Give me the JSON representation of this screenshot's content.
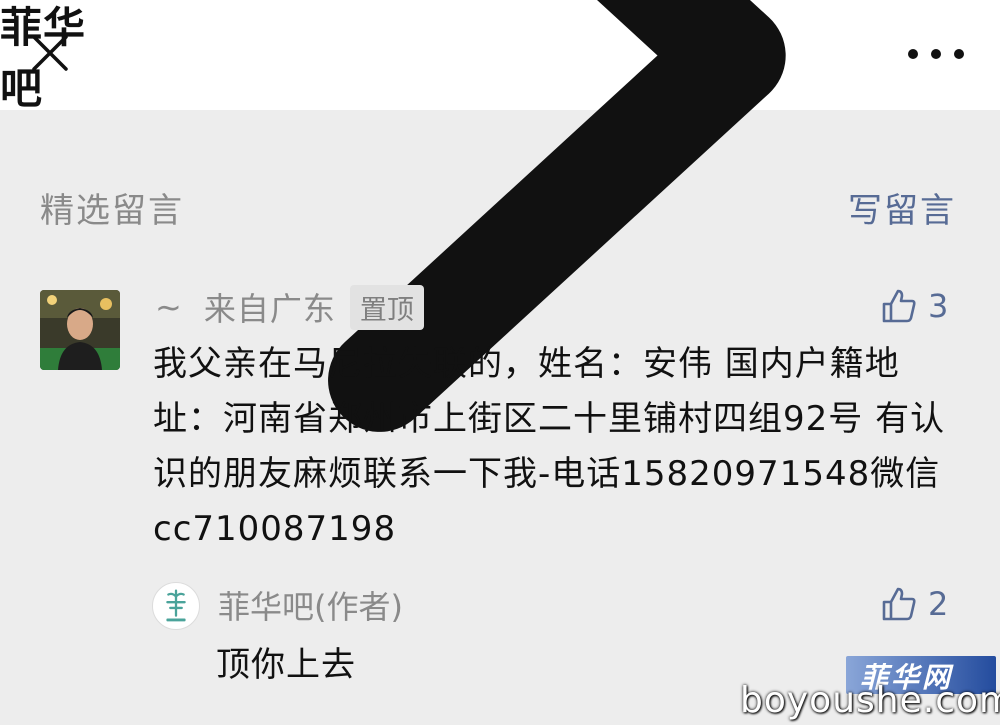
{
  "nav": {
    "title": "菲华吧"
  },
  "section": {
    "label": "精选留言",
    "write_label": "写留言"
  },
  "comment": {
    "name": "~",
    "location": "来自广东",
    "pin_badge": "置顶",
    "likes": "3",
    "text": "我父亲在马尼拉失联的，姓名：安伟  国内户籍地址：河南省郑州市上街区二十里铺村四组92号  有认识的朋友麻烦联系一下我-电话15820971548微信cc710087198"
  },
  "reply": {
    "name": "菲华吧(作者)",
    "likes": "2",
    "text": "顶你上去"
  },
  "watermark": {
    "logo_text": "菲华网",
    "site": "boyoushe.com"
  },
  "colors": {
    "link": "#576b95",
    "meta": "#8a8a8a",
    "background": "#ededed"
  },
  "icons": [
    "close-icon",
    "chevron-right-icon",
    "more-icon",
    "thumbs-up-icon"
  ]
}
